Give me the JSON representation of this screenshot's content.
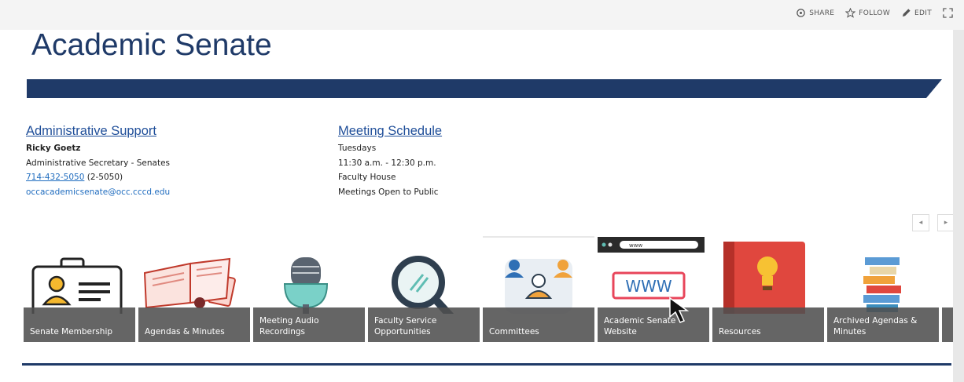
{
  "topbar": {
    "share_label": "SHARE",
    "follow_label": "FOLLOW",
    "edit_label": "EDIT"
  },
  "page": {
    "title": "Academic Senate",
    "banner_color": "#1f3a68"
  },
  "admin": {
    "heading": "Administrative Support",
    "name": "Ricky Goetz",
    "role": "Administrative Secretary - Senates",
    "phone": "714-432-5050",
    "extension": "(2-5050)",
    "email": "occacademicsenate@occ.cccd.edu"
  },
  "meeting": {
    "heading": "Meeting Schedule",
    "day": "Tuesdays",
    "time": "11:30 a.m. - 12:30 p.m.",
    "location": "Faculty House",
    "note": "Meetings Open to Public"
  },
  "tiles": [
    {
      "label": "Senate Membership",
      "icon": "badge-icon"
    },
    {
      "label": "Agendas & Minutes",
      "icon": "open-book-icon"
    },
    {
      "label": "Meeting Audio Recordings",
      "icon": "microphone-icon"
    },
    {
      "label": "Faculty Service Opportunities",
      "icon": "magnifier-icon"
    },
    {
      "label": "Committees",
      "icon": "group-icon"
    },
    {
      "label": "Academic Senate Website",
      "icon": "www-icon"
    },
    {
      "label": "Resources",
      "icon": "lightbulb-book-icon"
    },
    {
      "label": "Archived Agendas & Minutes",
      "icon": "stacked-books-icon"
    }
  ],
  "browser_address_text": "www"
}
